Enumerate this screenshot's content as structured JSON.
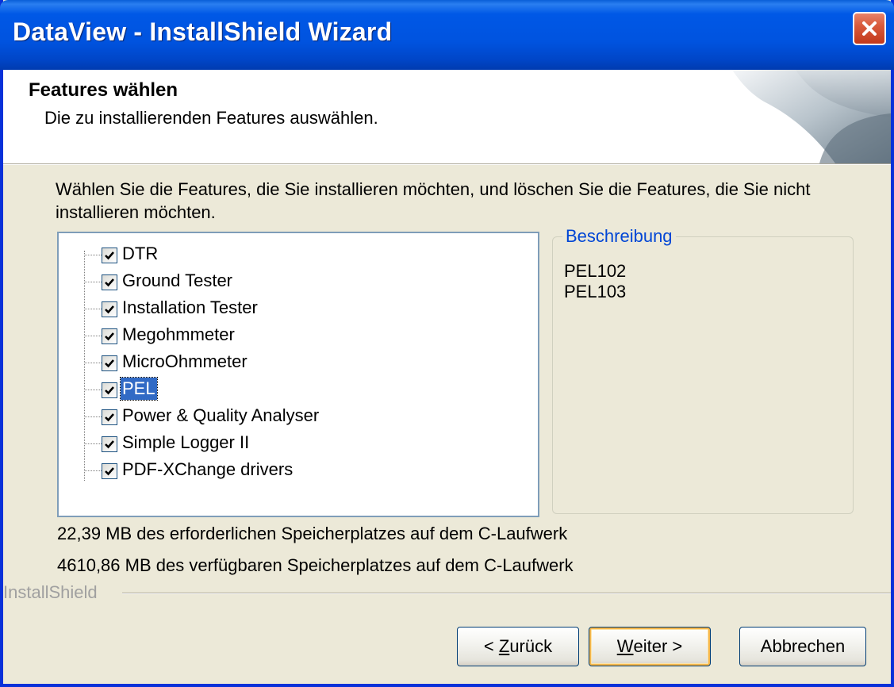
{
  "window": {
    "title": "DataView - InstallShield Wizard"
  },
  "header": {
    "title": "Features wählen",
    "subtitle": "Die zu installierenden Features auswählen."
  },
  "instructions": "Wählen Sie die Features, die Sie installieren möchten, und löschen Sie die Features, die Sie nicht installieren möchten.",
  "features": [
    {
      "label": "DTR",
      "checked": true,
      "selected": false
    },
    {
      "label": "Ground Tester",
      "checked": true,
      "selected": false
    },
    {
      "label": "Installation Tester",
      "checked": true,
      "selected": false
    },
    {
      "label": "Megohmmeter",
      "checked": true,
      "selected": false
    },
    {
      "label": "MicroOhmmeter",
      "checked": true,
      "selected": false
    },
    {
      "label": "PEL",
      "checked": true,
      "selected": true
    },
    {
      "label": "Power & Quality Analyser",
      "checked": true,
      "selected": false
    },
    {
      "label": "Simple Logger II",
      "checked": true,
      "selected": false
    },
    {
      "label": "PDF-XChange drivers",
      "checked": true,
      "selected": false
    }
  ],
  "description": {
    "legend": "Beschreibung",
    "lines": [
      "PEL102",
      "PEL103"
    ]
  },
  "disk": {
    "required": "22,39 MB des erforderlichen Speicherplatzes auf dem C-Laufwerk",
    "available": "4610,86 MB des verfügbaren Speicherplatzes auf dem C-Laufwerk"
  },
  "brand": "InstallShield",
  "buttons": {
    "back": {
      "prefix": "< ",
      "accel": "Z",
      "rest": "urück"
    },
    "next": {
      "accel": "W",
      "rest": "eiter >"
    },
    "cancel": "Abbrechen"
  },
  "colors": {
    "titlebar": "#0054e3",
    "selection": "#316ac5",
    "close": "#d9582f",
    "legend": "#0046d5"
  }
}
